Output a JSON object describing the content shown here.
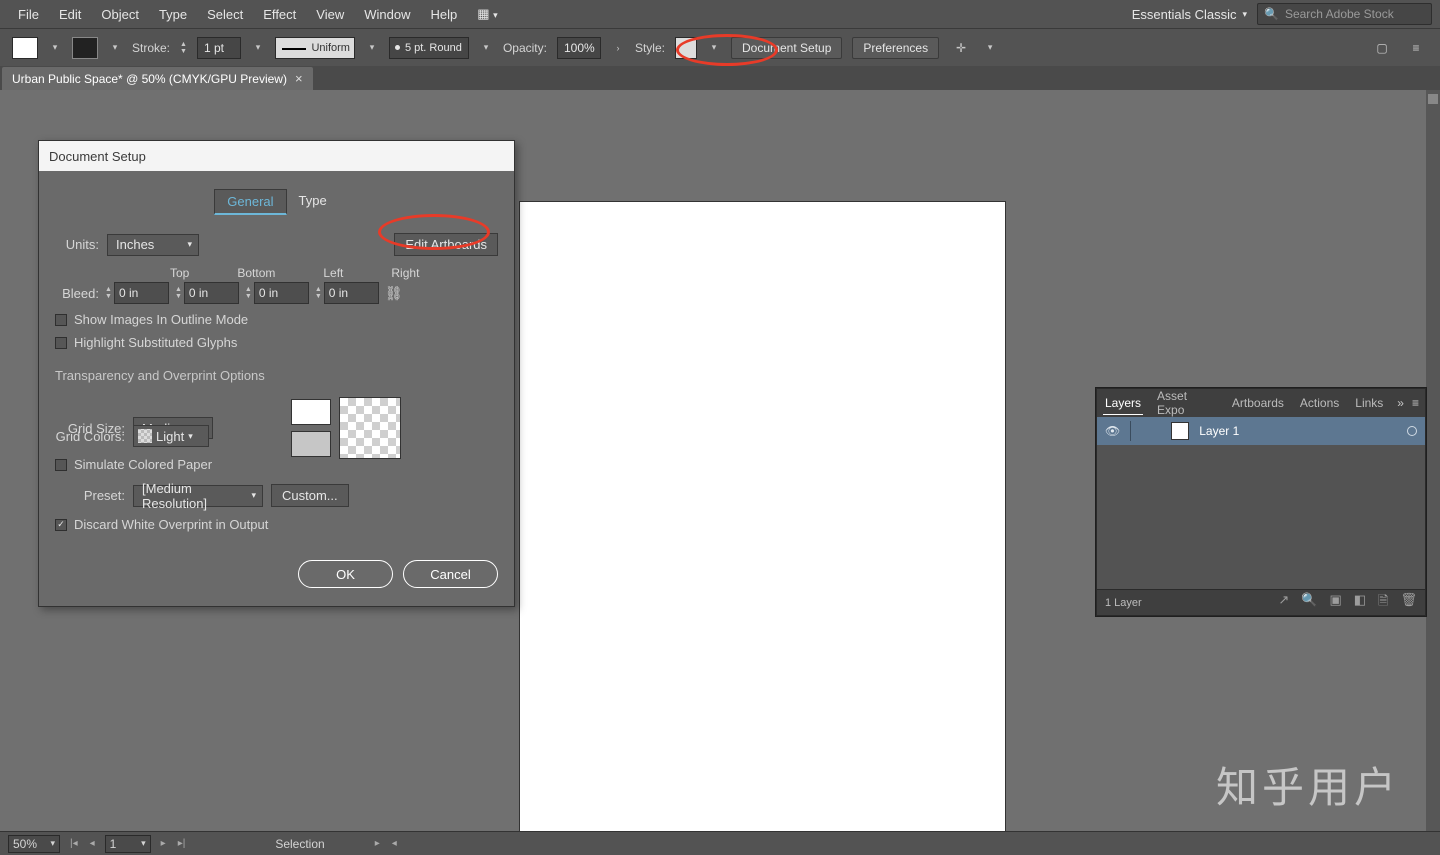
{
  "menu": {
    "items": [
      "File",
      "Edit",
      "Object",
      "Type",
      "Select",
      "Effect",
      "View",
      "Window",
      "Help"
    ]
  },
  "workspace": {
    "label": "Essentials Classic"
  },
  "search": {
    "placeholder": "Search Adobe Stock"
  },
  "ctrl": {
    "stroke_label": "Stroke:",
    "stroke_val": "1 pt",
    "uniform": "Uniform",
    "brush": "5 pt. Round",
    "opacity_label": "Opacity:",
    "opacity_val": "100%",
    "style_label": "Style:",
    "docsetup": "Document Setup",
    "prefs": "Preferences"
  },
  "doctab": {
    "title": "Urban Public Space* @ 50% (CMYK/GPU Preview)"
  },
  "dialog": {
    "title": "Document Setup",
    "tab_general": "General",
    "tab_type": "Type",
    "units_label": "Units:",
    "units_val": "Inches",
    "edit_artboards": "Edit Artboards",
    "bleed_label": "Bleed:",
    "top": "Top",
    "bottom": "Bottom",
    "left": "Left",
    "right": "Right",
    "bv_top": "0 in",
    "bv_bottom": "0 in",
    "bv_left": "0 in",
    "bv_right": "0 in",
    "chk_outline": "Show Images In Outline Mode",
    "chk_glyphs": "Highlight Substituted Glyphs",
    "section_trans": "Transparency and Overprint Options",
    "gridsize_label": "Grid Size:",
    "gridsize_val": "Medium",
    "gridcolors_label": "Grid Colors:",
    "gridcolors_val": "Light",
    "chk_simulate": "Simulate Colored Paper",
    "preset_label": "Preset:",
    "preset_val": "[Medium Resolution]",
    "custom": "Custom...",
    "chk_discard": "Discard White Overprint in Output",
    "ok": "OK",
    "cancel": "Cancel"
  },
  "layers": {
    "tabs": [
      "Layers",
      "Asset Expo",
      "Artboards",
      "Actions",
      "Links"
    ],
    "layer1": "Layer 1",
    "count": "1 Layer"
  },
  "status": {
    "zoom": "50%",
    "artboard": "1",
    "tool": "Selection"
  },
  "watermark": "知乎用户"
}
